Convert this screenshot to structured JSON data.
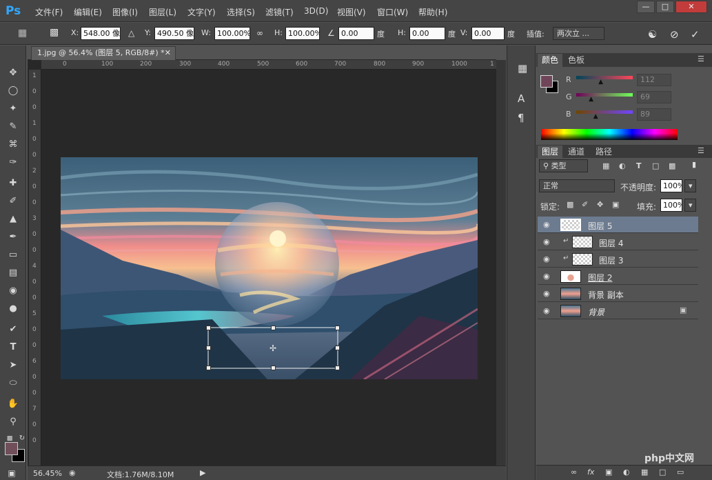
{
  "app": {
    "logo": "Ps"
  },
  "menu": [
    "文件(F)",
    "编辑(E)",
    "图像(I)",
    "图层(L)",
    "文字(Y)",
    "选择(S)",
    "滤镜(T)",
    "3D(D)",
    "视图(V)",
    "窗口(W)",
    "帮助(H)"
  ],
  "options": {
    "x_label": "X:",
    "x_value": "548.00 像",
    "y_label": "Y:",
    "y_value": "490.50 像",
    "w_label": "W:",
    "w_value": "100.00%",
    "h_label": "H:",
    "h_value": "100.00%",
    "angle_value": "0.00",
    "angle_unit": "度",
    "hskew_label": "H:",
    "hskew_value": "0.00",
    "hskew_unit": "度",
    "vskew_label": "V:",
    "vskew_value": "0.00",
    "vskew_unit": "度",
    "interp_label": "插值:",
    "interp_value": "两次立 ..."
  },
  "document": {
    "tab_title": "1.jpg @ 56.4% (图层 5, RGB/8#) *"
  },
  "ruler": {
    "h": [
      "0",
      "100",
      "200",
      "300",
      "400",
      "500",
      "600",
      "700",
      "800",
      "900",
      "1000",
      "1"
    ],
    "v": [
      "1",
      "0",
      "0",
      "1",
      "0",
      "0",
      "2",
      "0",
      "0",
      "3",
      "0",
      "0",
      "4",
      "0",
      "0",
      "5",
      "0",
      "0",
      "6",
      "0",
      "0",
      "7",
      "0",
      "0"
    ]
  },
  "status": {
    "zoom": "56.45%",
    "doc": "文档:1.76M/8.10M"
  },
  "color_panel": {
    "tabs": [
      "颜色",
      "色板"
    ],
    "r_label": "R",
    "r_value": "112",
    "g_label": "G",
    "g_value": "69",
    "b_label": "B",
    "b_value": "89",
    "fg_color": "#704559",
    "r_fraction": 0.44,
    "g_fraction": 0.27,
    "b_fraction": 0.35
  },
  "layers_panel": {
    "tabs": [
      "图层",
      "通道",
      "路径"
    ],
    "filter_label": "类型",
    "blend_mode": "正常",
    "opacity_label": "不透明度:",
    "opacity_value": "100%",
    "lock_label": "锁定:",
    "fill_label": "填充:",
    "fill_value": "100%",
    "layers": [
      {
        "name": "图层 5",
        "selected": true,
        "clipped": false
      },
      {
        "name": "图层 4",
        "selected": false,
        "clipped": true
      },
      {
        "name": "图层 3",
        "selected": false,
        "clipped": true
      },
      {
        "name": "图层 2",
        "selected": false,
        "clipped": false
      },
      {
        "name": "背景 副本",
        "selected": false,
        "clipped": false
      },
      {
        "name": "背景",
        "selected": false,
        "clipped": false
      }
    ]
  },
  "watermark": "php中文网",
  "colors": {
    "accent": "#31a8ff",
    "selected_row": "#6c7b8f",
    "close": "#c23c3c"
  }
}
